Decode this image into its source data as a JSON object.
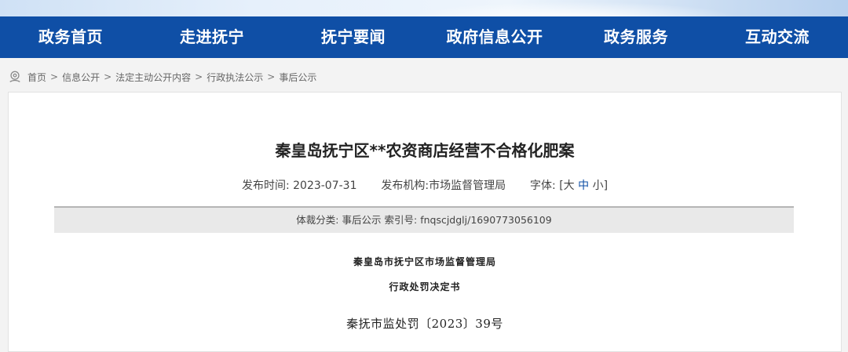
{
  "nav": {
    "items": [
      "政务首页",
      "走进抚宁",
      "抚宁要闻",
      "政府信息公开",
      "政务服务",
      "互动交流"
    ]
  },
  "breadcrumb": {
    "items": [
      "首页",
      "信息公开",
      "法定主动公开内容",
      "行政执法公示",
      "事后公示"
    ],
    "separator": ">"
  },
  "article": {
    "title": "秦皇岛抚宁区**农资商店经营不合格化肥案",
    "publish_time_label": "发布时间:",
    "publish_time": "2023-07-31",
    "publisher_label": "发布机构:",
    "publisher": "市场监督管理局",
    "font_label": "字体:",
    "font_open": "[",
    "font_large": "大",
    "font_medium": "中",
    "font_small": "小",
    "font_close": "]",
    "category_label": "体裁分类:",
    "category": "事后公示",
    "index_label": "索引号:",
    "index": "fnqscjdglj/1690773056109"
  },
  "document": {
    "agency": "秦皇岛市抚宁区市场监督管理局",
    "type": "行政处罚决定书",
    "number": "秦抚市监处罚〔2023〕39号"
  },
  "colors": {
    "nav_bg": "#0f4fa6",
    "page_bg": "#f3f3f3",
    "active_font": "#0f4fa6"
  }
}
